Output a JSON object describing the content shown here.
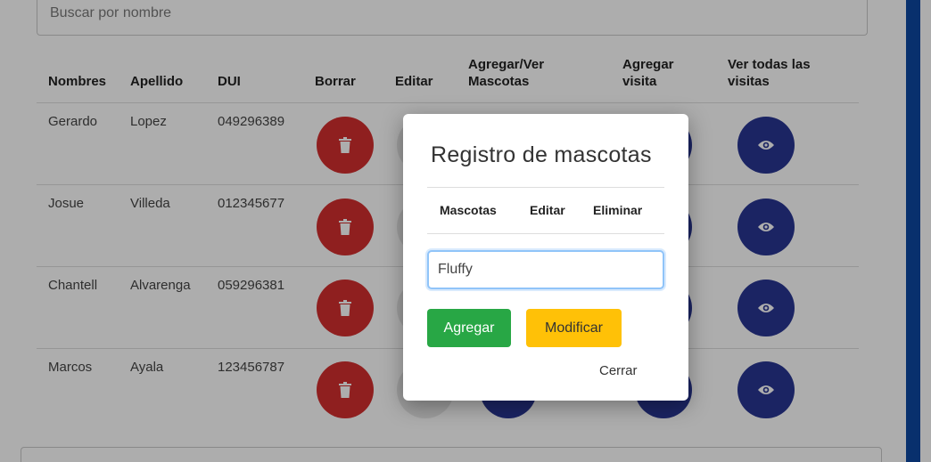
{
  "search": {
    "placeholder": "Buscar por nombre"
  },
  "table": {
    "headers": {
      "nombres": "Nombres",
      "apellido": "Apellido",
      "dui": "DUI",
      "borrar": "Borrar",
      "editar": "Editar",
      "mascotas_l1": "Agregar/Ver",
      "mascotas_l2": "Mascotas",
      "visita_l1": "Agregar",
      "visita_l2": "visita",
      "todas_l1": "Ver todas las",
      "todas_l2": "visitas"
    },
    "rows": [
      {
        "nombre": "Gerardo",
        "apellido": "Lopez",
        "dui": "049296389"
      },
      {
        "nombre": "Josue",
        "apellido": "Villeda",
        "dui": "012345677"
      },
      {
        "nombre": "Chantell",
        "apellido": "Alvarenga",
        "dui": "059296381"
      },
      {
        "nombre": "Marcos",
        "apellido": "Ayala",
        "dui": "123456787"
      }
    ]
  },
  "icons": {
    "delete": "trash-icon",
    "view": "eye-icon"
  },
  "colors": {
    "delete_button": "#d32f2f",
    "view_button": "#283593",
    "sidebar_accent": "#0d47a1",
    "agregar_button": "#28a745",
    "modificar_button": "#ffc107"
  },
  "modal": {
    "title": "Registro de mascotas",
    "col_mascotas": "Mascotas",
    "col_editar": "Editar",
    "col_eliminar": "Eliminar",
    "input_value": "Fluffy",
    "agregar_label": "Agregar",
    "modificar_label": "Modificar",
    "cerrar_label": "Cerrar"
  }
}
